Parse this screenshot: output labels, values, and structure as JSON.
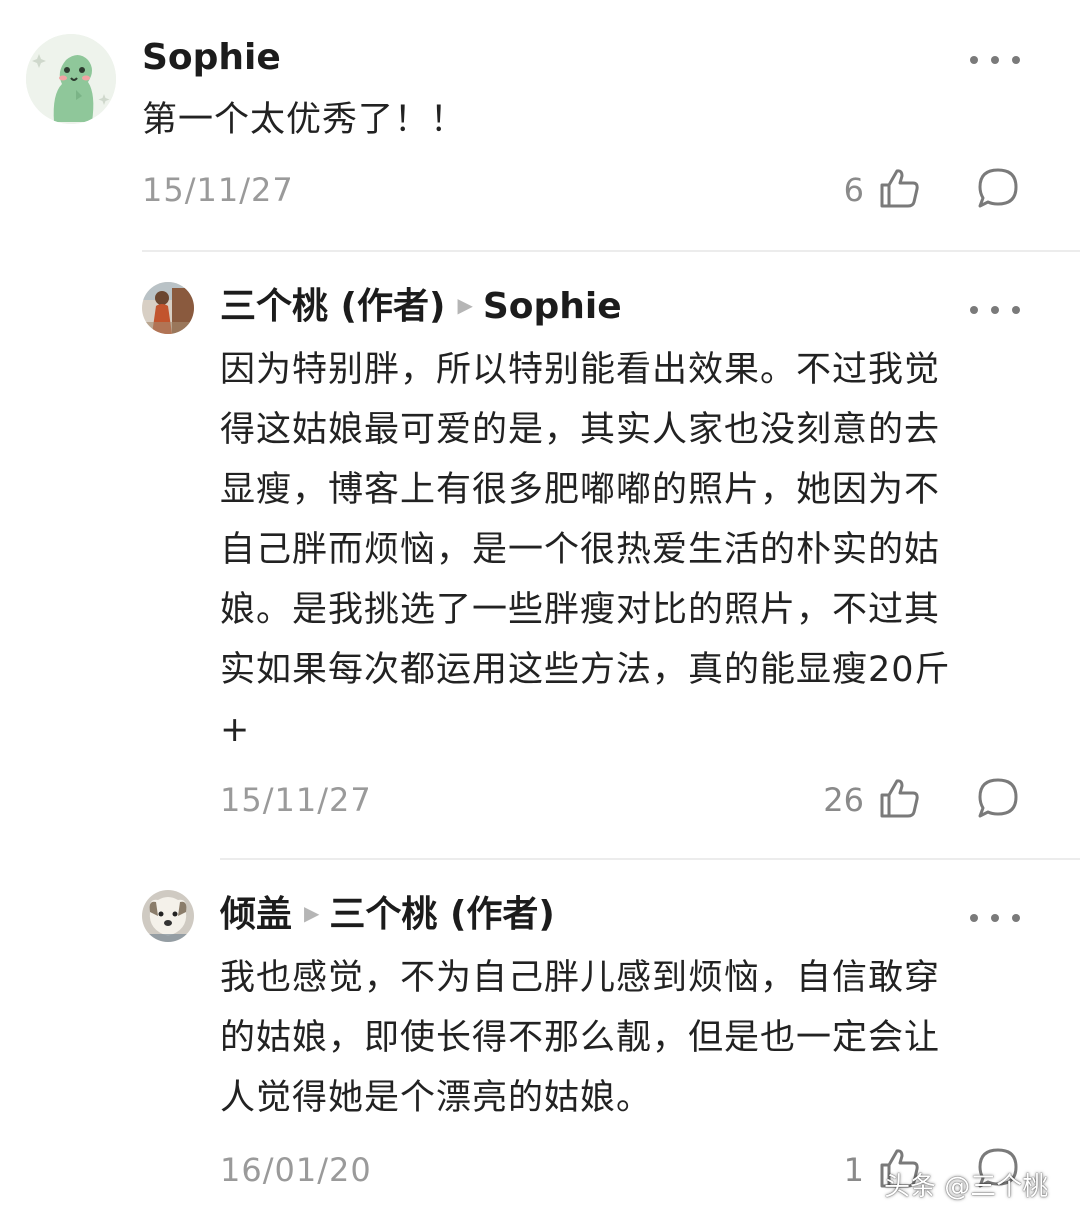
{
  "comments": [
    {
      "author": "Sophie",
      "reply_to": "",
      "text": "第一个太优秀了！！",
      "date": "15/11/27",
      "likes": "6"
    },
    {
      "author": "三个桃 (作者)",
      "reply_to": "Sophie",
      "text_lines": [
        "因为特别胖，所以特别能看出效果。不过我觉",
        "得这姑娘最可爱的是，其实人家也没刻意的去",
        "显瘦，博客上有很多肥嘟嘟的照片，她因为不",
        "自己胖而烦恼，是一个很热爱生活的朴实的姑",
        "娘。是我挑选了一些胖瘦对比的照片，不过其",
        "实如果每次都运用这些方法，真的能显瘦20斤",
        "+"
      ],
      "date": "15/11/27",
      "likes": "26"
    },
    {
      "author": "倾盖",
      "reply_to": "三个桃 (作者)",
      "text_lines": [
        "我也感觉，不为自己胖儿感到烦恼，自信敢穿",
        "的姑娘，即使长得不那么靓，但是也一定会让",
        "人觉得她是个漂亮的姑娘。"
      ],
      "date": "16/01/20",
      "likes": "1"
    }
  ],
  "watermark": "头条 @三个桃",
  "icons": [
    "more-dots-icon",
    "thumbs-up-icon",
    "reply-bubble-icon"
  ],
  "colors": {
    "text": "#222222",
    "muted": "#9a9a9a",
    "divider": "#ececec"
  }
}
